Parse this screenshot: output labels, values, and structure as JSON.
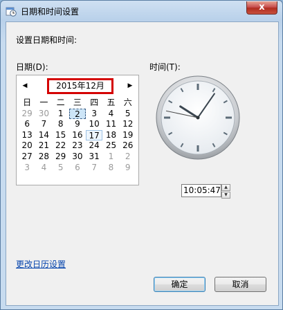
{
  "window": {
    "title": "日期和时间设置",
    "close_glyph": "x"
  },
  "heading": "设置日期和时间:",
  "date_label": "日期(D):",
  "time_label": "时间(T):",
  "calendar": {
    "prev_icon": "◀",
    "next_icon": "▶",
    "month_title": "2015年12月",
    "weekdays": [
      "日",
      "一",
      "二",
      "三",
      "四",
      "五",
      "六"
    ],
    "weeks": [
      [
        {
          "d": "29",
          "other": true
        },
        {
          "d": "30",
          "other": true
        },
        {
          "d": "1"
        },
        {
          "d": "2",
          "selected": true
        },
        {
          "d": "3"
        },
        {
          "d": "4"
        },
        {
          "d": "5"
        }
      ],
      [
        {
          "d": "6"
        },
        {
          "d": "7"
        },
        {
          "d": "8"
        },
        {
          "d": "9"
        },
        {
          "d": "10"
        },
        {
          "d": "11"
        },
        {
          "d": "12"
        }
      ],
      [
        {
          "d": "13"
        },
        {
          "d": "14"
        },
        {
          "d": "15"
        },
        {
          "d": "16"
        },
        {
          "d": "17",
          "today": true
        },
        {
          "d": "18"
        },
        {
          "d": "19"
        }
      ],
      [
        {
          "d": "20"
        },
        {
          "d": "21"
        },
        {
          "d": "22"
        },
        {
          "d": "23"
        },
        {
          "d": "24"
        },
        {
          "d": "25"
        },
        {
          "d": "26"
        }
      ],
      [
        {
          "d": "27"
        },
        {
          "d": "28"
        },
        {
          "d": "29"
        },
        {
          "d": "30"
        },
        {
          "d": "31"
        },
        {
          "d": "1",
          "other": true
        },
        {
          "d": "2",
          "other": true
        }
      ],
      [
        {
          "d": "3",
          "other": true
        },
        {
          "d": "4",
          "other": true
        },
        {
          "d": "5",
          "other": true
        },
        {
          "d": "6",
          "other": true
        },
        {
          "d": "7",
          "other": true
        },
        {
          "d": "8",
          "other": true
        },
        {
          "d": "9",
          "other": true
        }
      ]
    ]
  },
  "clock": {
    "hours": 10,
    "minutes": 5,
    "seconds": 47
  },
  "time_value": "10:05:47",
  "change_calendar_link": "更改日历设置",
  "ok_label": "确定",
  "cancel_label": "取消",
  "colors": {
    "highlight_border": "#d40000",
    "link": "#0645ad"
  }
}
